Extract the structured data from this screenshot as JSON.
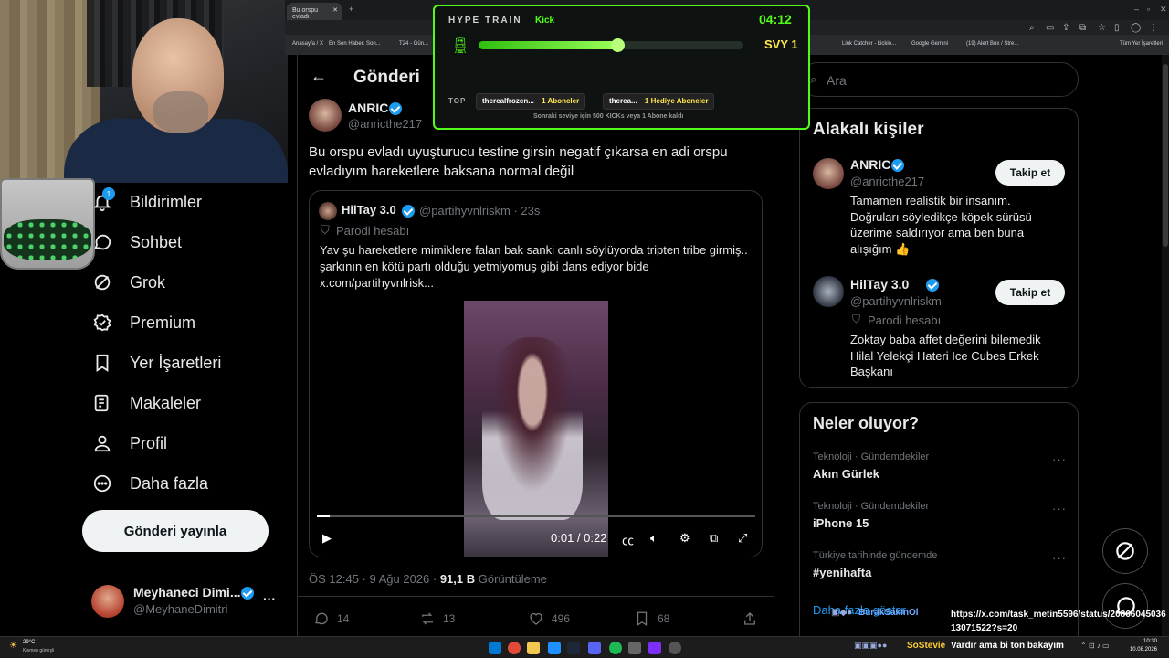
{
  "browser": {
    "tab_title": "Bu orspu evladı",
    "new_tab": "+",
    "bookmarks": [
      "Anasayfa / X",
      "En Son Haber: Son...",
      "T24 - Gün...",
      "Link Catcher - kicklo...",
      "Google Gemini",
      "(19) Alert Box / Stre...",
      "Tüm Yer İşaretleri"
    ]
  },
  "hype_train": {
    "title": "HYPE TRAIN",
    "platform": "Kick",
    "timer": "04:12",
    "level": "SVY 1",
    "progress": 0.53,
    "top_label": "TOP",
    "contributors": [
      {
        "name": "therealfrozen...",
        "value": "1 Aboneler"
      },
      {
        "name": "therea...",
        "value": "1 Hediye Aboneler"
      }
    ],
    "footer": "Sonraki seviye için 500 KICKs veya 1 Abone kaldı"
  },
  "nav": {
    "notification_count": "1",
    "items": [
      {
        "label": "Bildirimler",
        "icon": "bell-icon"
      },
      {
        "label": "Sohbet",
        "icon": "chat-icon"
      },
      {
        "label": "Grok",
        "icon": "grok-icon"
      },
      {
        "label": "Premium",
        "icon": "premium-icon"
      },
      {
        "label": "Yer İşaretleri",
        "icon": "bookmark-icon"
      },
      {
        "label": "Makaleler",
        "icon": "articles-icon"
      },
      {
        "label": "Profil",
        "icon": "profile-icon"
      },
      {
        "label": "Daha fazla",
        "icon": "more-icon"
      }
    ],
    "post_button": "Gönderi yayınla",
    "account": {
      "name": "Meyhaneci Dimi...",
      "handle": "@MeyhaneDimitri",
      "more": "···"
    }
  },
  "main": {
    "header_title": "Gönderi",
    "post": {
      "author_name": "ANRIC",
      "author_handle": "@anricthe217",
      "text": "Bu orspu evladı uyuşturucu testine girsin negatif çıkarsa en adi orspu evladıyım hareketlere baksana normal değil",
      "timestamp": "ÖS 12:45 · 9 Ağu 2026 · ",
      "views_count": "91,1 B",
      "views_label": " Görüntüleme"
    },
    "quote": {
      "author_name": "HilTay 3.0",
      "author_handle": "@partihyvnlriskm · 23s",
      "parody_label": "Parodi hesabı",
      "text": "Yav şu hareketlere mimiklere falan bak sanki canlı söylüyorda tripten tribe girmiş.. şarkının en kötü partı olduğu yetmiyomuş gibi dans ediyor bide x.com/partihyvnlrisk...",
      "video_time": "0:01 / 0:22",
      "video_progress": 0.03
    },
    "actions": {
      "replies": "14",
      "reposts": "13",
      "likes": "496",
      "bookmarks": "68"
    }
  },
  "right": {
    "search_placeholder": "Ara",
    "related_title": "Alakalı kişiler",
    "people": [
      {
        "name": "ANRIC",
        "handle": "@anricthe217",
        "bio": "Tamamen realistik bir insanım. Doğruları söyledikçe köpek sürüsü üzerime saldırıyor ama ben buna alışığım 👍",
        "follow": "Takip et"
      },
      {
        "name": "HilTay 3.0",
        "handle": "@partihyvnlriskm",
        "parody": "Parodi hesabı",
        "bio": "Zoktay baba affet değerini bilemedik Hilal Yelekçi Hateri Ice Cubes Erkek Başkanı",
        "follow": "Takip et"
      }
    ],
    "trends_title": "Neler oluyor?",
    "trends": [
      {
        "category": "Teknoloji · Gündemdekiler",
        "name": "Akın Gürlek"
      },
      {
        "category": "Teknoloji · Gündemdekiler",
        "name": "iPhone 15"
      },
      {
        "category": "Türkiye tarihinde gündemde",
        "name": "#yenihafta"
      }
    ],
    "show_more": "Daha fazla göster"
  },
  "chat_overlay": {
    "user": "BurakSakinOl",
    "url": "https://x.com/task_metin5596/status/2086604503613071522?s=20",
    "user2": "SoStevie",
    "message2": "Vardır ama bi ton bakayım"
  },
  "taskbar": {
    "weather_temp": "29°C",
    "weather_desc": "Kısmen güneşli",
    "time": "10:30",
    "date": "10.08.2026"
  },
  "colors": {
    "accent": "#1d9bf0",
    "kick_green": "#53fc18",
    "bg": "#000000"
  }
}
